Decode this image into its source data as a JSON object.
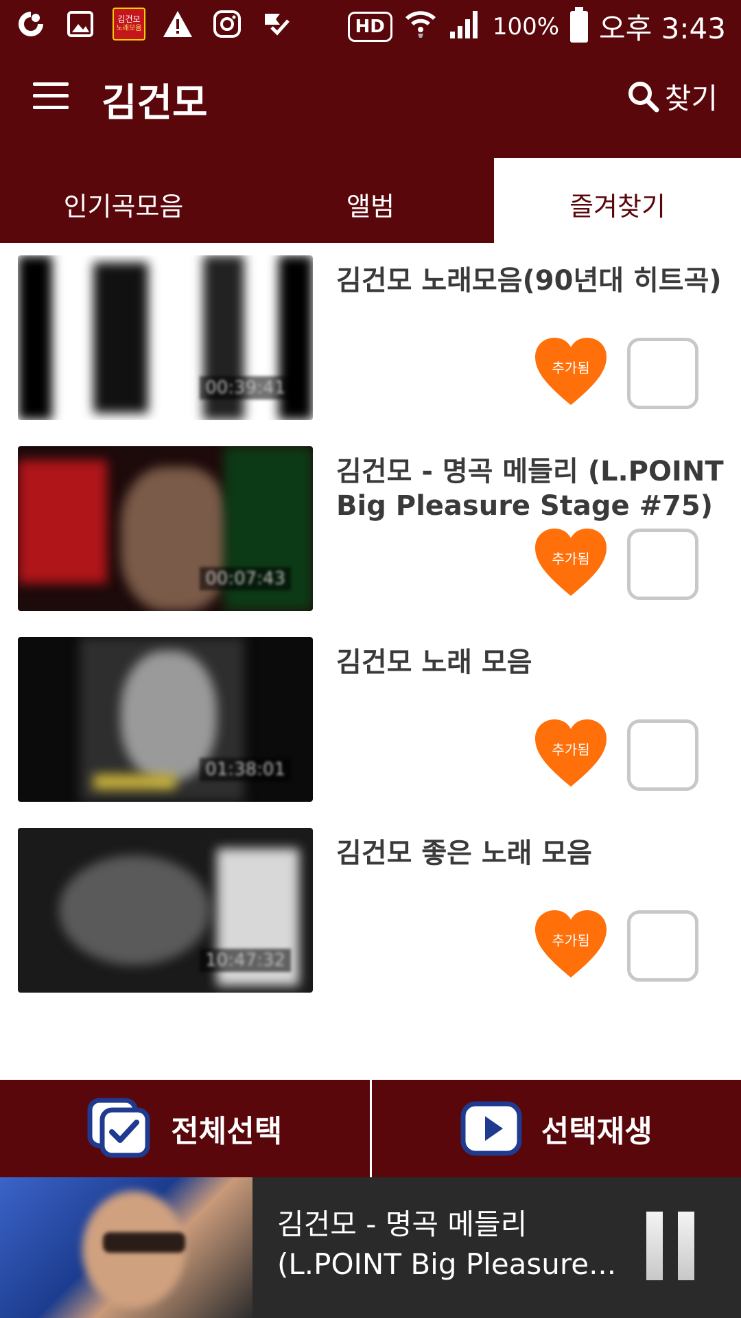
{
  "statusbar": {
    "app_badge_line1": "김건모",
    "app_badge_line2": "노래모음",
    "hd": "HD",
    "battery": "100%",
    "time": "오후 3:43"
  },
  "header": {
    "title": "김건모",
    "search_label": "찾기"
  },
  "tabs": [
    {
      "label": "인기곡모음",
      "active": false
    },
    {
      "label": "앨범",
      "active": false
    },
    {
      "label": "즐겨찾기",
      "active": true
    }
  ],
  "items": [
    {
      "title": "김건모 노래모음(90년대 히트곡)",
      "duration": "00:39:41",
      "favorite_label": "추가됨"
    },
    {
      "title": "김건모 - 명곡 메들리 (L.POINT Big Pleasure Stage #75)",
      "duration": "00:07:43",
      "favorite_label": "추가됨"
    },
    {
      "title": "김건모 노래 모음",
      "duration": "01:38:01",
      "favorite_label": "추가됨"
    },
    {
      "title": "김건모 좋은 노래 모음",
      "duration": "10:47:32",
      "favorite_label": "추가됨"
    }
  ],
  "actions": {
    "select_all": "전체선택",
    "play_selected": "선택재생"
  },
  "player": {
    "title_line1": "김건모 - 명곡 메들리",
    "title_line2": "(L.POINT Big Pleasure..."
  },
  "colors": {
    "primary": "#5a070b",
    "heart": "#ff6f0a",
    "icon_blue": "#1f3a8f"
  }
}
